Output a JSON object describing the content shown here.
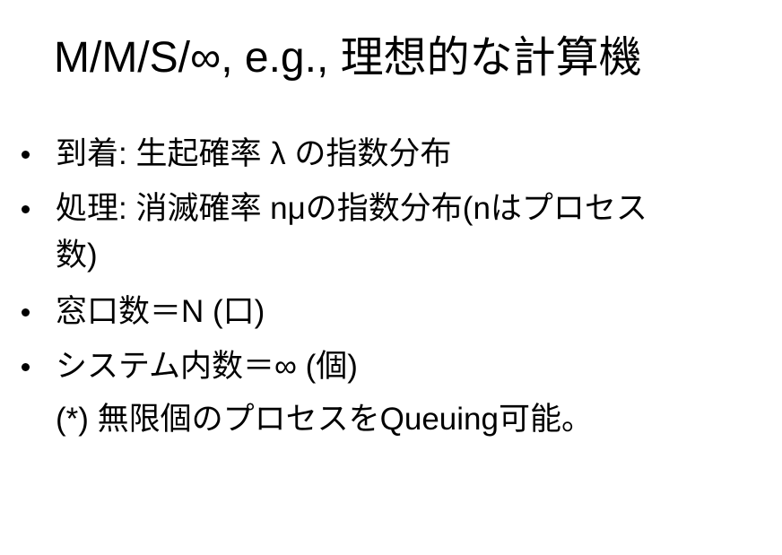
{
  "slide": {
    "title": "M/M/S/∞, e.g., 理想的な計算機",
    "bullets": [
      {
        "text": "到着: 生起確率 λ の指数分布"
      },
      {
        "text": "処理: 消滅確率 nμの指数分布(nはプロセス",
        "continuation": "数)"
      },
      {
        "text": "窓口数＝N (口)"
      },
      {
        "text": "システム内数＝∞ (個)"
      }
    ],
    "note": "(*) 無限個のプロセスをQueuing可能。"
  }
}
